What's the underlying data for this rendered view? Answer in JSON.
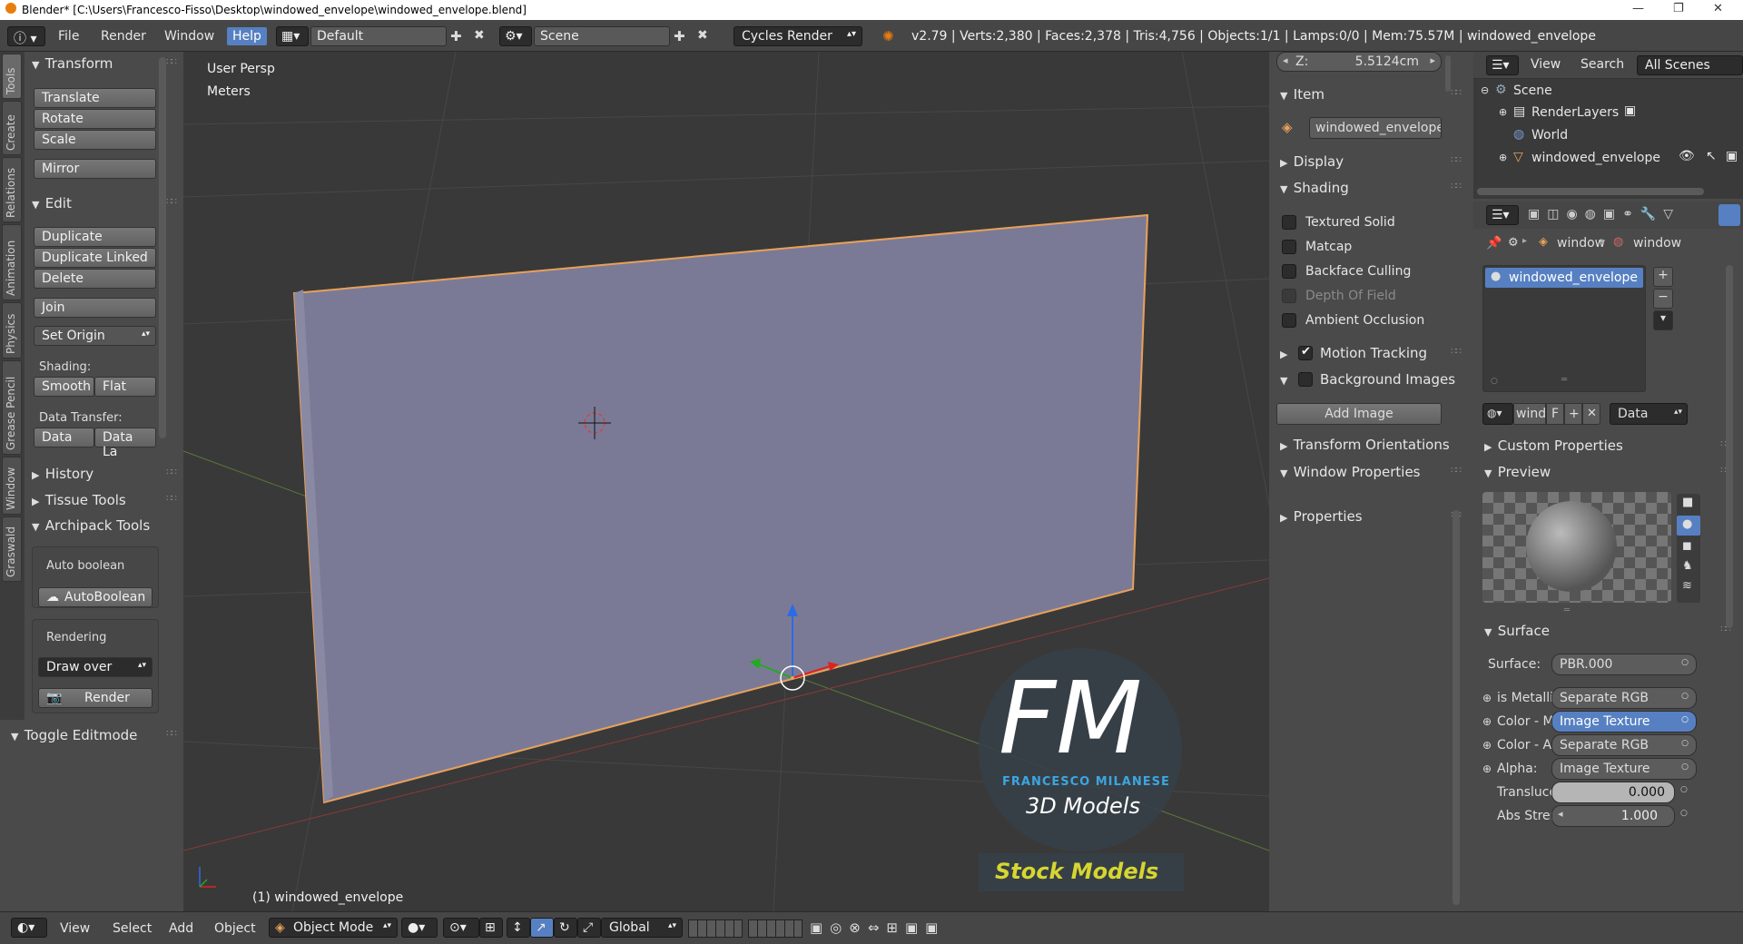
{
  "window": {
    "title": "Blender* [C:\\Users\\Francesco-Fisso\\Desktop\\windowed_envelope\\windowed_envelope.blend]",
    "controls": [
      "—",
      "❐",
      "✕"
    ]
  },
  "topbar": {
    "menus": [
      "File",
      "Render",
      "Window",
      "Help"
    ],
    "layout": "Default",
    "scene": "Scene",
    "engine": "Cycles Render",
    "stats": "v2.79 | Verts:2,380 | Faces:2,378 | Tris:4,756 | Objects:1/1 | Lamps:0/0 | Mem:75.57M | windowed_envelope"
  },
  "side_tabs": [
    "Tools",
    "Create",
    "Relations",
    "Animation",
    "Physics",
    "Grease Pencil",
    "Window",
    "Graswald"
  ],
  "toolshelf": {
    "transform_header": "Transform",
    "transform_buttons": [
      "Translate",
      "Rotate",
      "Scale",
      "Mirror"
    ],
    "edit_header": "Edit",
    "edit_buttons": [
      "Duplicate",
      "Duplicate Linked",
      "Delete",
      "Join"
    ],
    "set_origin": "Set Origin",
    "shading_label": "Shading:",
    "shading_smooth": "Smooth",
    "shading_flat": "Flat",
    "data_transfer_label": "Data Transfer:",
    "data_btn": "Data",
    "data_la_btn": "Data La",
    "history": "History",
    "tissue": "Tissue Tools",
    "archipack": "Archipack Tools",
    "auto_boolean_label": "Auto boolean",
    "auto_boolean_btn": "AutoBoolean",
    "rendering_label": "Rendering",
    "draw_over": "Draw over",
    "render_btn": "Render",
    "toggle_editmode": "Toggle Editmode"
  },
  "viewport": {
    "view_label": "User Persp",
    "units_label": "Meters",
    "object_label": "(1) windowed_envelope",
    "watermark_fm": "FM",
    "watermark_name": "FRANCESCO MILANESE",
    "watermark_sub": "3D Models",
    "stock": "Stock Models"
  },
  "npanel": {
    "z_label": "Z:",
    "z_value": "5.5124cm",
    "item": "Item",
    "item_name": "windowed_envelope",
    "display": "Display",
    "shading": "Shading",
    "shading_opts": [
      {
        "label": "Textured Solid",
        "checked": false,
        "disabled": false
      },
      {
        "label": "Matcap",
        "checked": false,
        "disabled": false
      },
      {
        "label": "Backface Culling",
        "checked": false,
        "disabled": false
      },
      {
        "label": "Depth Of Field",
        "checked": false,
        "disabled": true
      },
      {
        "label": "Ambient Occlusion",
        "checked": false,
        "disabled": false
      }
    ],
    "motion_tracking": "Motion Tracking",
    "background_images": "Background Images",
    "add_image": "Add Image",
    "transform_orient": "Transform Orientations",
    "window_props": "Window Properties",
    "properties": "Properties"
  },
  "outliner": {
    "view": "View",
    "search": "Search",
    "all_scenes": "All Scenes",
    "items": [
      "Scene",
      "RenderLayers",
      "World",
      "windowed_envelope"
    ]
  },
  "properties": {
    "crumb1": "window",
    "crumb2": "window",
    "material_slot": "windowed_envelope",
    "mat_name": "windo",
    "mat_f": "F",
    "data_dd": "Data",
    "custom_props": "Custom Properties",
    "preview": "Preview",
    "surface_header": "Surface",
    "surface_label": "Surface:",
    "surface_value": "PBR.000",
    "rows": [
      {
        "label": "is Metallic",
        "value": "Separate RGB",
        "blue": false
      },
      {
        "label": "Color - Ma",
        "value": "Image Texture",
        "blue": true
      },
      {
        "label": "Color - Ab",
        "value": "Separate RGB",
        "blue": false
      },
      {
        "label": "Alpha:",
        "value": "Image Texture",
        "blue": false
      }
    ],
    "translu_label": "Transluce",
    "translu_value": "0.000",
    "abs_label": "Abs Stren",
    "abs_value": "1.000"
  },
  "bottombar": {
    "menus": [
      "View",
      "Select",
      "Add",
      "Object"
    ],
    "mode": "Object Mode",
    "orientation": "Global"
  }
}
